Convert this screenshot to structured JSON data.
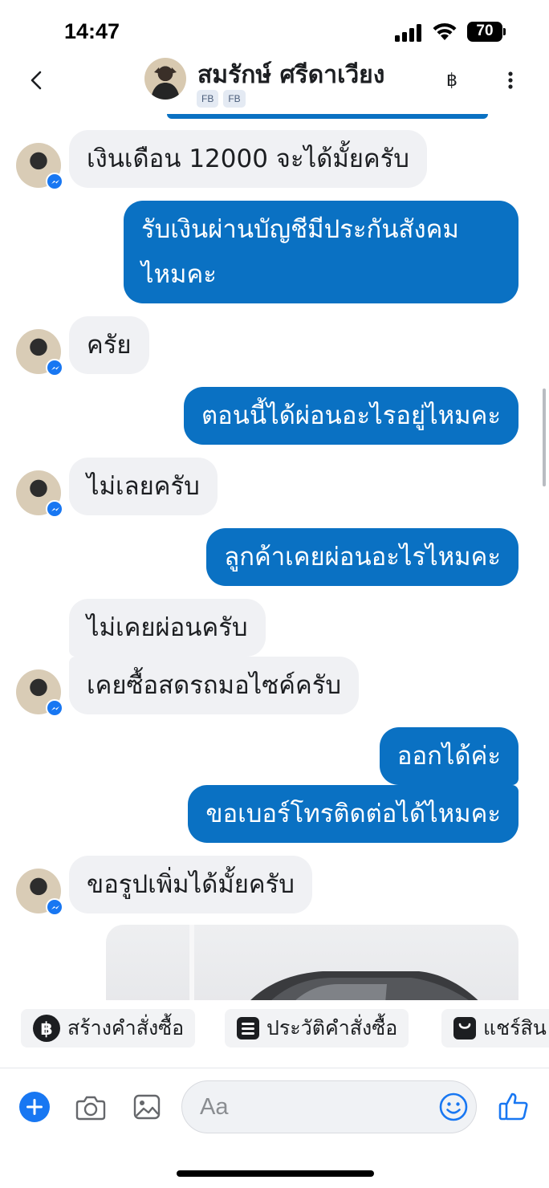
{
  "status_bar": {
    "time": "14:47",
    "battery": "70"
  },
  "header": {
    "contact_name": "สมรักษ์ ศรีดาเวียง",
    "tags": [
      "FB",
      "FB"
    ],
    "currency_symbol": "฿"
  },
  "messages": [
    {
      "direction": "incoming",
      "text": "เงินเดือน 12000 จะได้มั้ยครับ"
    },
    {
      "direction": "outgoing",
      "text": "รับเงินผ่านบัญชีมีประกันสังคม",
      "text_line2": "ไหมคะ"
    },
    {
      "direction": "incoming",
      "text": "ครัย"
    },
    {
      "direction": "outgoing",
      "text": "ตอนนี้ได้ผ่อนอะไรอยู่ไหมคะ"
    },
    {
      "direction": "incoming",
      "text": "ไม่เลยครับ"
    },
    {
      "direction": "outgoing",
      "text": "ลูกค้าเคยผ่อนอะไรไหมคะ"
    },
    {
      "direction": "incoming",
      "text": "ไม่เคยผ่อนครับ"
    },
    {
      "direction": "incoming",
      "text": "เคยซื้อสดรถมอไซค์ครับ"
    },
    {
      "direction": "outgoing",
      "text": "ออกได้ค่ะ"
    },
    {
      "direction": "outgoing",
      "text": "ขอเบอร์โทรติดต่อได้ไหมคะ"
    },
    {
      "direction": "incoming",
      "text": "ขอรูปเพิ่มได้มั้ยครับ"
    }
  ],
  "quick_actions": [
    {
      "icon": "baht-circle-icon",
      "label": "สร้างคำสั่งซื้อ"
    },
    {
      "icon": "list-icon",
      "label": "ประวัติคำสั่งซื้อ"
    },
    {
      "icon": "bag-icon",
      "label": "แชร์สิน"
    }
  ],
  "composer": {
    "placeholder": "Aa"
  },
  "colors": {
    "outgoing_bubble": "#0a71c3",
    "incoming_bubble": "#f0f1f4",
    "messenger_blue": "#1877f2"
  }
}
